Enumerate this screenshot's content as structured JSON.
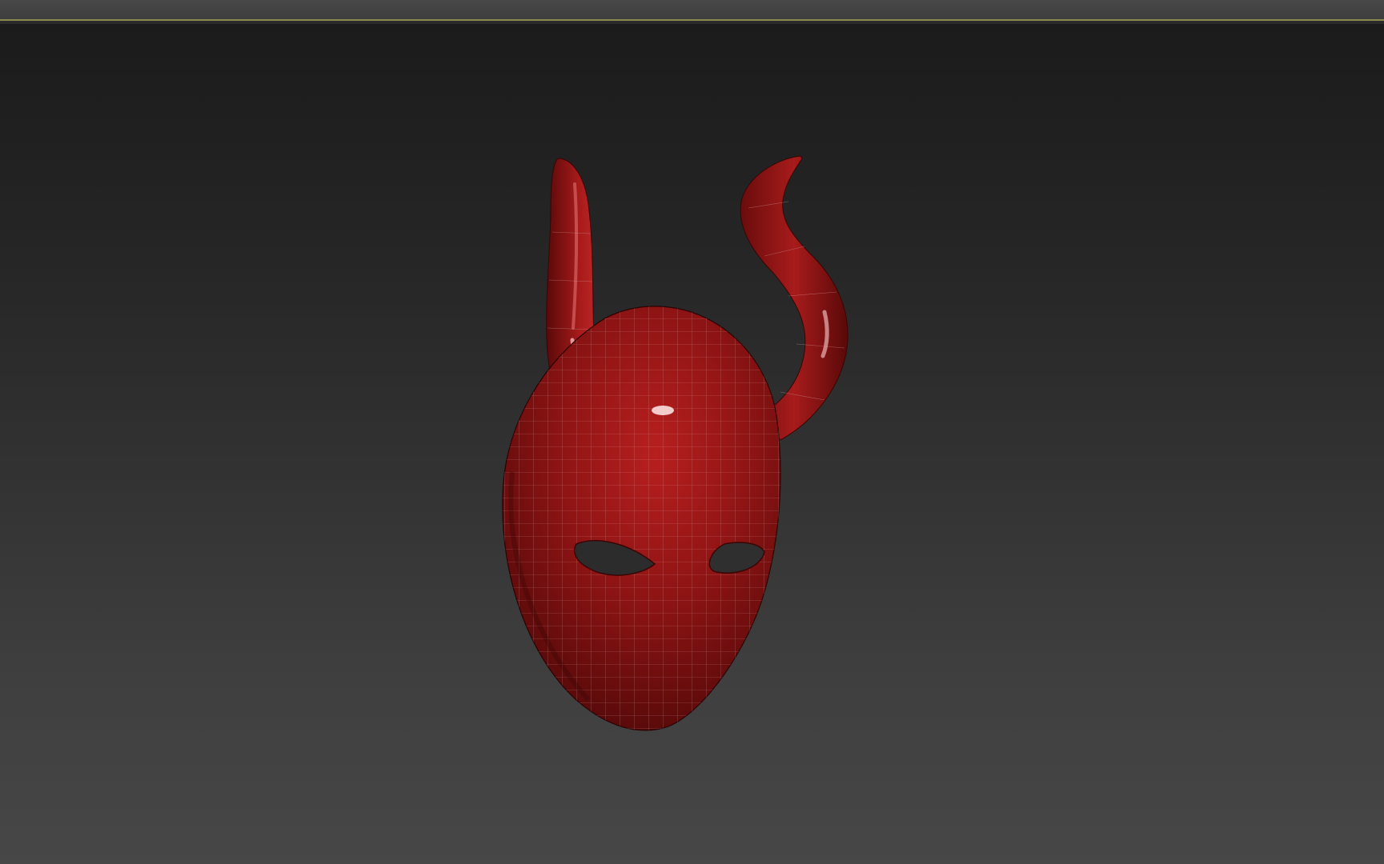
{
  "app": {
    "window_title": ""
  },
  "viewport": {
    "background_top": "#1b1b1b",
    "background_bottom": "#474747"
  },
  "scene": {
    "object_name": "",
    "object_type": "horned-mask-mesh",
    "material_color": "#8f1414",
    "highlight_color": "#c42b2b",
    "wireframe_color": "#d9b0b0",
    "wireframe_visible": true
  },
  "icons": {
    "status_strip": "viewport-border-strip"
  }
}
